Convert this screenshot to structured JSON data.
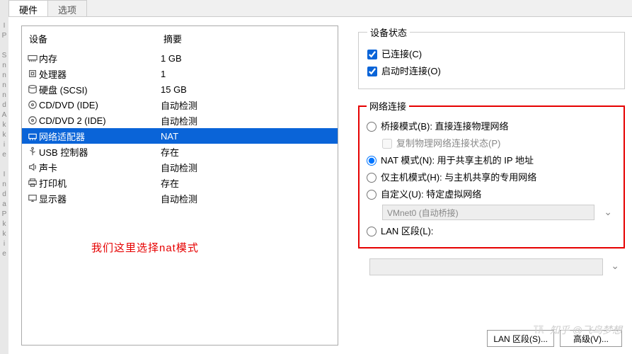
{
  "tabs": {
    "hardware": "硬件",
    "options": "选项"
  },
  "headers": {
    "device": "设备",
    "summary": "摘要"
  },
  "devices": [
    {
      "icon": "memory",
      "name": "内存",
      "summary": "1 GB",
      "selected": false
    },
    {
      "icon": "cpu",
      "name": "处理器",
      "summary": "1",
      "selected": false
    },
    {
      "icon": "disk",
      "name": "硬盘 (SCSI)",
      "summary": "15 GB",
      "selected": false
    },
    {
      "icon": "cd",
      "name": "CD/DVD (IDE)",
      "summary": "自动检测",
      "selected": false
    },
    {
      "icon": "cd",
      "name": "CD/DVD 2 (IDE)",
      "summary": "自动检测",
      "selected": false
    },
    {
      "icon": "net",
      "name": "网络适配器",
      "summary": "NAT",
      "selected": true
    },
    {
      "icon": "usb",
      "name": "USB 控制器",
      "summary": "存在",
      "selected": false
    },
    {
      "icon": "sound",
      "name": "声卡",
      "summary": "自动检测",
      "selected": false
    },
    {
      "icon": "printer",
      "name": "打印机",
      "summary": "存在",
      "selected": false
    },
    {
      "icon": "display",
      "name": "显示器",
      "summary": "自动检测",
      "selected": false
    }
  ],
  "note": "我们这里选择nat模式",
  "status": {
    "legend": "设备状态",
    "connected": "已连接(C)",
    "connect_at_poweron": "启动时连接(O)"
  },
  "netconn": {
    "legend": "网络连接",
    "bridged": "桥接模式(B): 直接连接物理网络",
    "replicate": "复制物理网络连接状态(P)",
    "nat": "NAT 模式(N): 用于共享主机的 IP 地址",
    "hostonly": "仅主机模式(H): 与主机共享的专用网络",
    "custom": "自定义(U): 特定虚拟网络",
    "custom_value": "VMnet0 (自动桥接)",
    "lanseg": "LAN 区段(L):"
  },
  "buttons": {
    "lan_segments": "LAN 区段(S)...",
    "advanced": "高级(V)..."
  },
  "watermark": "知乎 @飞鸟梦想"
}
